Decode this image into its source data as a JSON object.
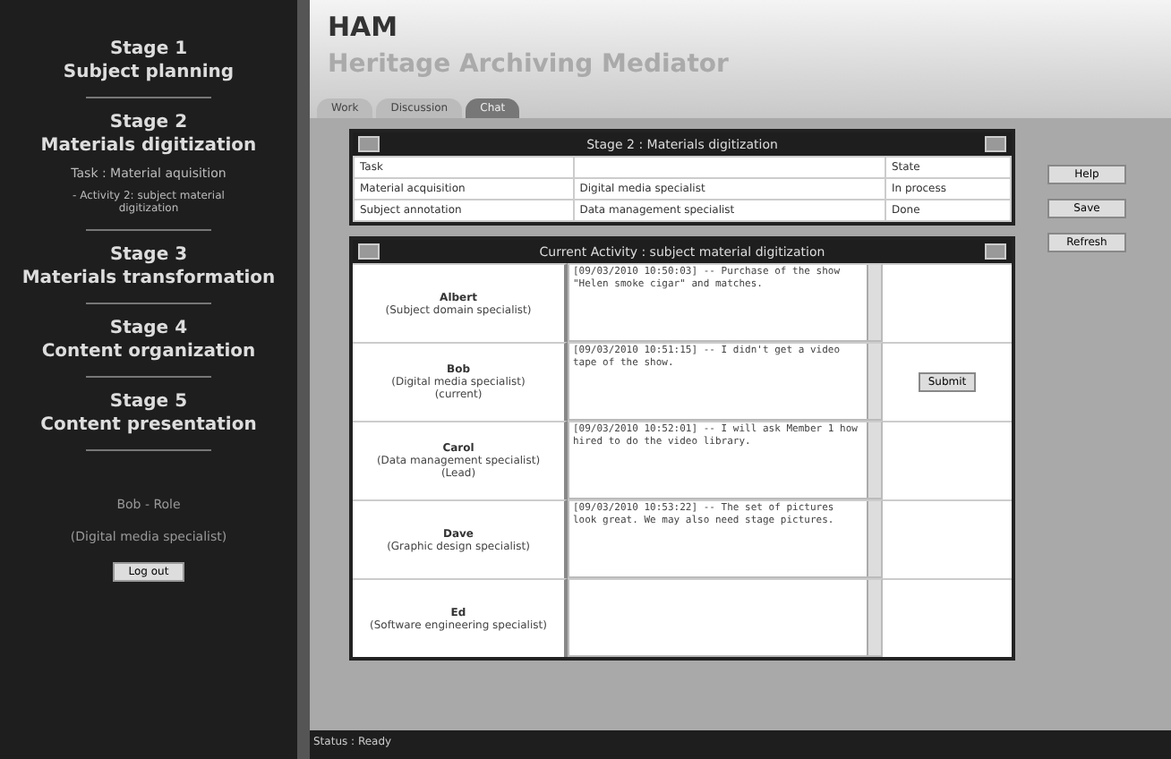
{
  "sidebar": {
    "stages": [
      {
        "stage": "Stage 1",
        "name": "Subject planning"
      },
      {
        "stage": "Stage 2",
        "name": "Materials digitization",
        "children": [
          {
            "label": "Task : Material aquisition"
          },
          {
            "label": "- Activity 2: subject material digitization"
          }
        ]
      },
      {
        "stage": "Stage 3",
        "name": "Materials transformation"
      },
      {
        "stage": "Stage 4",
        "name": "Content organization"
      },
      {
        "stage": "Stage 5",
        "name": "Content presentation"
      }
    ],
    "user": "Bob - Role",
    "role": "(Digital media specialist)",
    "logout": "Log out"
  },
  "header": {
    "logo": "HAM",
    "title": "Heritage Archiving Mediator"
  },
  "tabs": [
    {
      "label": "Work",
      "selected": false
    },
    {
      "label": "Discussion",
      "selected": false
    },
    {
      "label": "Chat",
      "selected": true
    }
  ],
  "stage_panel": {
    "title": "Stage 2 : Materials digitization",
    "columns": [
      "Task",
      null,
      "State"
    ],
    "rows": [
      [
        "Material acquisition",
        "Digital media specialist",
        "In process"
      ],
      [
        "Subject annotation",
        "Data management specialist",
        "Done"
      ]
    ]
  },
  "activity_panel": {
    "title": "Current Activity : subject material digitization",
    "members": [
      {
        "name": "Albert",
        "role": "(Subject domain specialist)",
        "comment": "[09/03/2010 10:50:03] -- Purchase of the show \"Helen smoke cigar\" and matches."
      },
      {
        "name": "Bob",
        "role": "(Digital media specialist)",
        "note": "(current)",
        "comment": "[09/03/2010 10:51:15] -- I didn't get a video tape of the show.",
        "submit": "Submit"
      },
      {
        "name": "Carol",
        "role": "(Data management specialist)",
        "note": "(Lead)",
        "comment": "[09/03/2010 10:52:01] -- I will ask Member 1 how hired to do the video library."
      },
      {
        "name": "Dave",
        "role": "(Graphic design specialist)",
        "comment": "[09/03/2010 10:53:22] -- The set of pictures look great. We may also need stage pictures."
      },
      {
        "name": "Ed",
        "role": "(Software engineering specialist)"
      }
    ]
  },
  "side_buttons": [
    "Help",
    "Save",
    "Refresh"
  ],
  "status_bar": "Status : Ready"
}
